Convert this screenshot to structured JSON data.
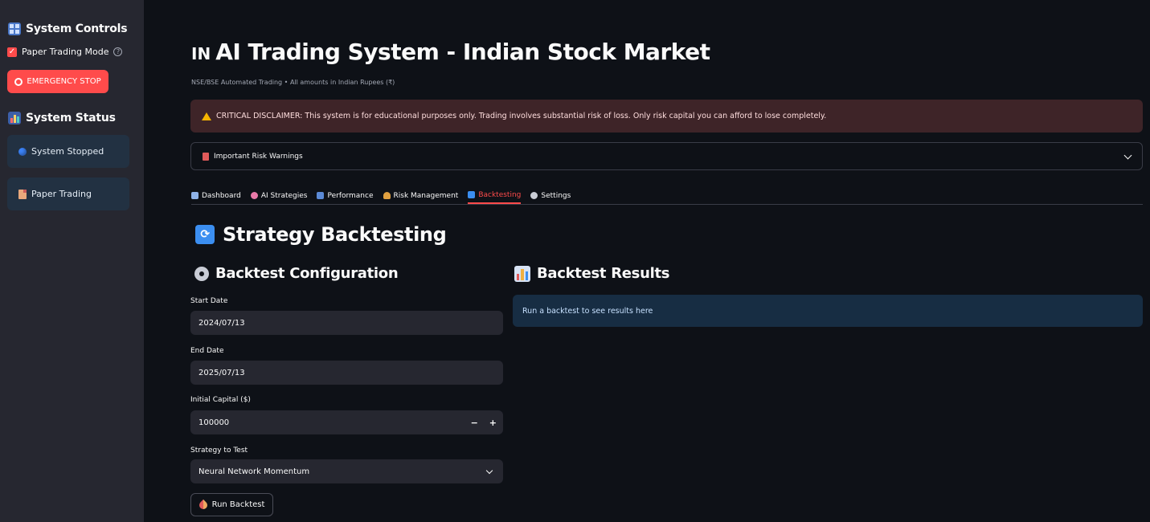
{
  "sidebar": {
    "controls_heading": "System Controls",
    "paper_trading_label": "Paper Trading Mode",
    "paper_trading_checked": true,
    "emergency_stop_label": "EMERGENCY STOP",
    "status_heading": "System Status",
    "status_card_label": "System Stopped",
    "mode_card_label": "Paper Trading"
  },
  "header": {
    "flag_text": "IN",
    "title": "AI Trading System - Indian Stock Market",
    "subtitle": "NSE/BSE Automated Trading • All amounts in Indian Rupees (₹)"
  },
  "disclaimer": {
    "text": "CRITICAL DISCLAIMER: This system is for educational purposes only. Trading involves substantial risk of loss. Only risk capital you can afford to lose completely."
  },
  "expander": {
    "label": "Important Risk Warnings"
  },
  "tabs": [
    {
      "label": "Dashboard",
      "icon": "chart-icon",
      "color": "#8fb3e8"
    },
    {
      "label": "AI Strategies",
      "icon": "brain-icon",
      "color": "#e879a8"
    },
    {
      "label": "Performance",
      "icon": "bar-chart-icon",
      "color": "#5b8ad6"
    },
    {
      "label": "Risk Management",
      "icon": "scale-icon",
      "color": "#e0a040"
    },
    {
      "label": "Backtesting",
      "icon": "sync-icon",
      "color": "#3b8ef0",
      "active": true
    },
    {
      "label": "Settings",
      "icon": "gear-icon",
      "color": "#c9cdd6"
    }
  ],
  "section": {
    "heading": "Strategy Backtesting",
    "config_heading": "Backtest Configuration",
    "results_heading": "Backtest Results",
    "results_placeholder": "Run a backtest to see results here"
  },
  "form": {
    "start_date_label": "Start Date",
    "start_date_value": "2024/07/13",
    "end_date_label": "End Date",
    "end_date_value": "2025/07/13",
    "capital_label": "Initial Capital ($)",
    "capital_value": "100000",
    "minus": "−",
    "plus": "+",
    "strategy_label": "Strategy to Test",
    "strategy_value": "Neural Network Momentum",
    "run_button_label": "Run Backtest"
  },
  "colors": {
    "accent": "#ff4b4b",
    "background": "#0e1117",
    "sidebar": "#262730",
    "info_box": "#172d43",
    "error_box": "#3e2428"
  }
}
